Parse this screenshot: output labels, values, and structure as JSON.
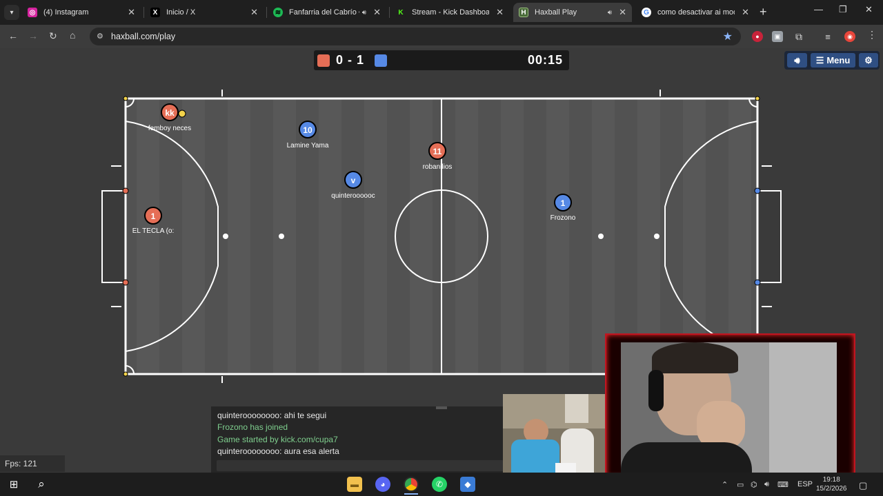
{
  "browser": {
    "tab_menu_icon": "chevron-down-icon",
    "tabs": [
      {
        "title": "(4) Instagram",
        "icon": "instagram-icon",
        "color": "#d6249f",
        "active": false,
        "audio": false
      },
      {
        "title": "Inicio / X",
        "icon": "x-icon",
        "color": "#000000",
        "active": false,
        "audio": false
      },
      {
        "title": "Fanfarria del Cabrío • P",
        "icon": "spotify-icon",
        "color": "#1db954",
        "active": false,
        "audio": true
      },
      {
        "title": "Stream - Kick Dashboard",
        "icon": "kick-icon",
        "color": "#53fc18",
        "active": false,
        "audio": false
      },
      {
        "title": "Haxball Play",
        "icon": "haxball-icon",
        "color": "#4a6b3a",
        "active": true,
        "audio": true
      },
      {
        "title": "como desactivar ai mod ki",
        "icon": "google-icon",
        "color": "#4285f4",
        "active": false,
        "audio": false
      }
    ],
    "url": "haxball.com/play"
  },
  "game": {
    "score": "0 - 1",
    "time": "00:15",
    "red_color": "#e56e56",
    "blue_color": "#5689e5",
    "menu_label": "Menu",
    "fps_label": "Fps: 121"
  },
  "players": [
    {
      "avatar": "kk",
      "name": "femboy neces",
      "team": "red"
    },
    {
      "avatar": "10",
      "name": "Lamine Yama",
      "team": "blue"
    },
    {
      "avatar": "11",
      "name": "robanilios",
      "team": "red"
    },
    {
      "avatar": "v",
      "name": "quinteroooooc",
      "team": "blue"
    },
    {
      "avatar": "1",
      "name": "EL TECLA (o:",
      "team": "red"
    },
    {
      "avatar": "1",
      "name": "Frozono",
      "team": "blue"
    }
  ],
  "chat": [
    {
      "text": "quinteroooooooo: ahi te segui",
      "system": false
    },
    {
      "text": "Frozono has joined",
      "system": true
    },
    {
      "text": "Game started by kick.com/cupa7",
      "system": true
    },
    {
      "text": "quinteroooooooo: aura esa alerta",
      "system": false
    }
  ],
  "taskbar": {
    "language": "ESP",
    "time": "19:18",
    "date": "15/2/2026"
  }
}
